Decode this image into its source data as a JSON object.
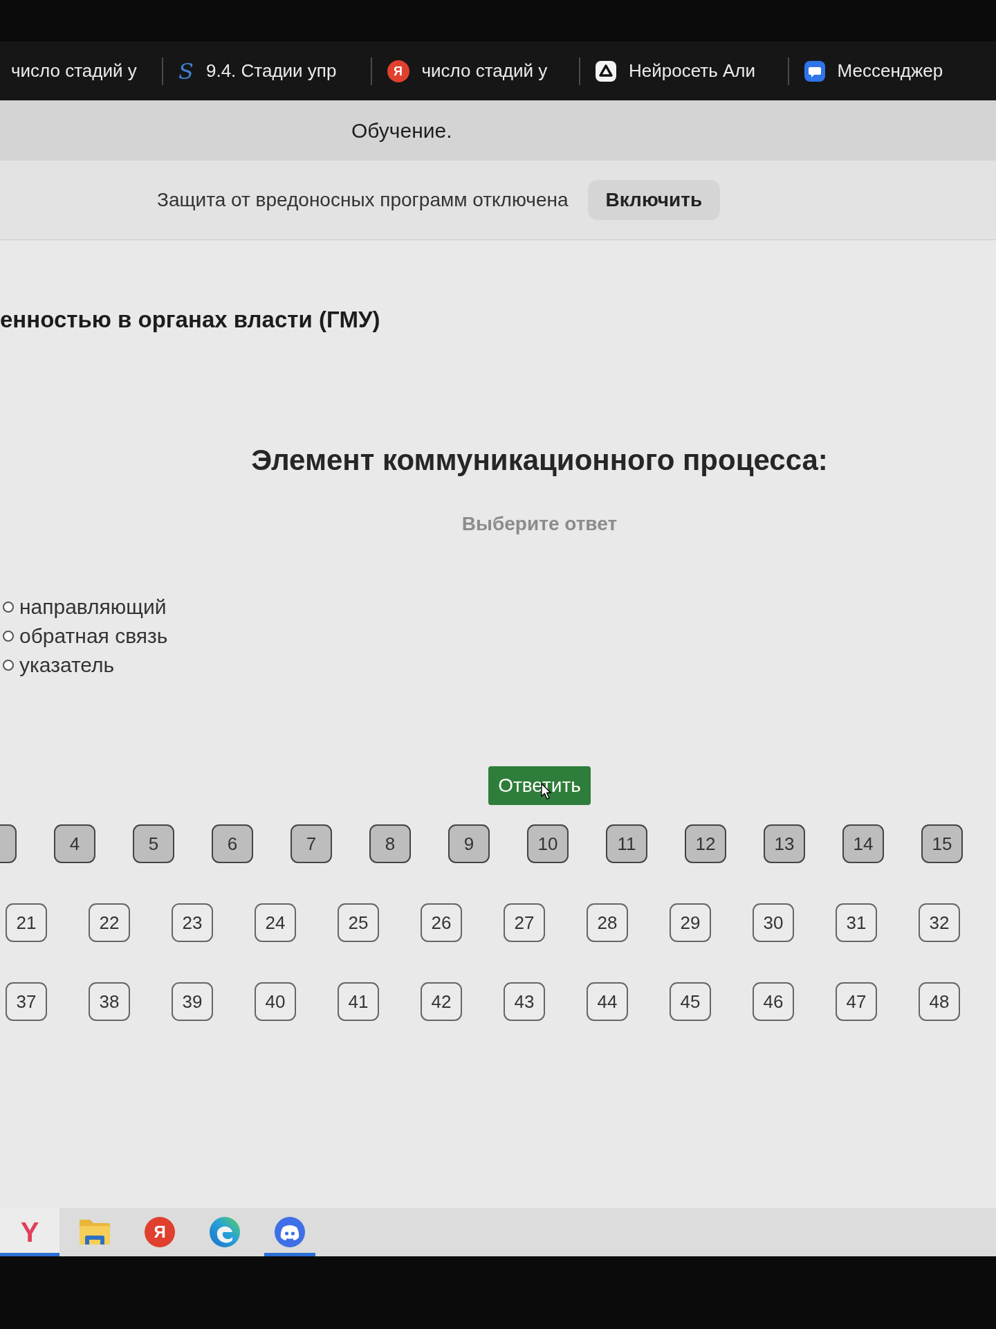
{
  "browser_tabs": [
    {
      "title": "число стадий у",
      "selected": false
    },
    {
      "icon": {
        "kind": "glyph",
        "glyph": "S"
      },
      "title": "9.4. Стадии упр",
      "selected": false
    },
    {
      "icon": {
        "kind": "badge",
        "glyph": "Я"
      },
      "title": "число стадий у",
      "selected": false
    },
    {
      "icon": {
        "kind": "alice"
      },
      "title": "Нейросеть Али",
      "selected": false
    },
    {
      "icon": {
        "kind": "messenger"
      },
      "title": "Мессенджер",
      "selected": false
    }
  ],
  "title_bar": {
    "title": "Обучение."
  },
  "notification_bar": {
    "message": "Защита от вредоносных программ отключена",
    "button": "Включить"
  },
  "page": {
    "heading": "енностью в органах власти (ГМУ)",
    "question": "Элемент коммуникационного процесса:",
    "instruction": "Выберите ответ",
    "options": [
      {
        "label": "направляющий",
        "selected": false
      },
      {
        "label": "обратная связь",
        "selected": false
      },
      {
        "label": "указатель",
        "selected": false
      }
    ],
    "submit_button": "Ответить"
  },
  "question_nav": {
    "rows": [
      {
        "items": [
          {
            "answered": true
          },
          {
            "label": "4",
            "answered": true
          },
          {
            "label": "5",
            "answered": true
          },
          {
            "label": "6",
            "answered": true
          },
          {
            "label": "7",
            "answered": true
          },
          {
            "label": "8",
            "answered": true
          },
          {
            "label": "9",
            "answered": true
          },
          {
            "label": "10",
            "answered": true
          },
          {
            "label": "11",
            "answered": true
          },
          {
            "label": "12",
            "answered": true
          },
          {
            "label": "13",
            "answered": true
          },
          {
            "label": "14",
            "answered": true
          },
          {
            "label": "15",
            "answered": true
          }
        ]
      },
      {
        "items": [
          {
            "label": "21",
            "answered": false
          },
          {
            "label": "22",
            "answered": false
          },
          {
            "label": "23",
            "answered": false
          },
          {
            "label": "24",
            "answered": false
          },
          {
            "label": "25",
            "answered": false
          },
          {
            "label": "26",
            "answered": false
          },
          {
            "label": "27",
            "answered": false
          },
          {
            "label": "28",
            "answered": false
          },
          {
            "label": "29",
            "answered": false
          },
          {
            "label": "30",
            "answered": false
          },
          {
            "label": "31",
            "answered": false
          },
          {
            "label": "32",
            "answered": false
          }
        ]
      },
      {
        "items": [
          {
            "label": "37",
            "answered": false
          },
          {
            "label": "38",
            "answered": false
          },
          {
            "label": "39",
            "answered": false
          },
          {
            "label": "40",
            "answered": false
          },
          {
            "label": "41",
            "answered": false
          },
          {
            "label": "42",
            "answered": false
          },
          {
            "label": "43",
            "answered": false
          },
          {
            "label": "44",
            "answered": false
          },
          {
            "label": "45",
            "answered": false
          },
          {
            "label": "46",
            "answered": false
          },
          {
            "label": "47",
            "answered": false
          },
          {
            "label": "48",
            "answered": false
          }
        ]
      }
    ]
  },
  "taskbar": {
    "items": [
      {
        "kind": "glyph",
        "glyph": "Y",
        "selected": true,
        "open": true
      },
      {
        "kind": "folder",
        "selected": false,
        "open": false
      },
      {
        "kind": "badge",
        "glyph": "Я",
        "selected": false,
        "open": false
      },
      {
        "kind": "edge",
        "selected": false,
        "open": false
      },
      {
        "kind": "discord",
        "selected": false,
        "open": true
      }
    ]
  }
}
